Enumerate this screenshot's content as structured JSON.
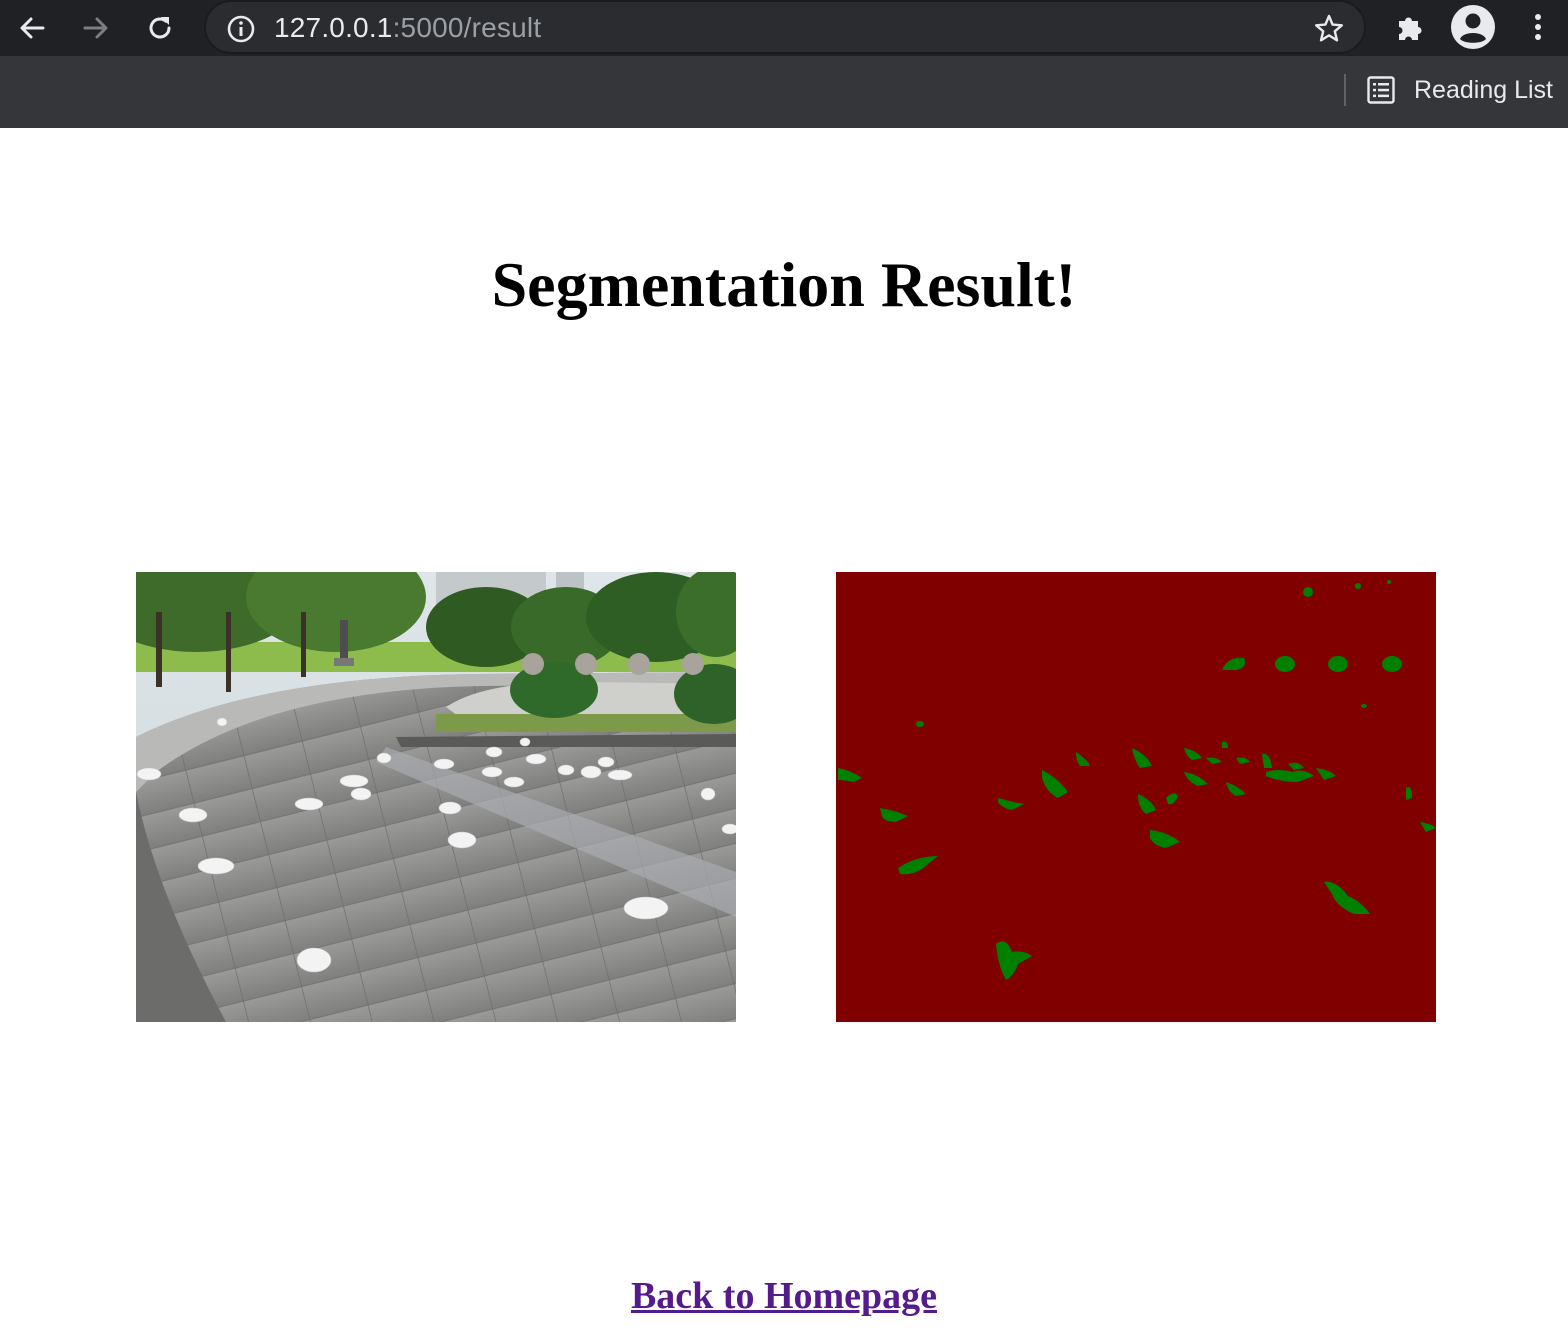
{
  "browser": {
    "url_host": "127.0.0.1",
    "url_path": ":5000/result",
    "reading_list_label": "Reading List",
    "icons": [
      "back-arrow-icon",
      "forward-arrow-icon",
      "reload-icon",
      "site-info-icon",
      "bookmark-star-icon",
      "extensions-puzzle-icon",
      "profile-avatar-icon",
      "more-menu-icon",
      "reading-list-icon"
    ]
  },
  "page": {
    "title": "Segmentation Result!",
    "link_label": "Back to Homepage"
  },
  "colors": {
    "mask_background": "#800000",
    "mask_foreground": "#008000",
    "visited_link": "#551a8b"
  }
}
